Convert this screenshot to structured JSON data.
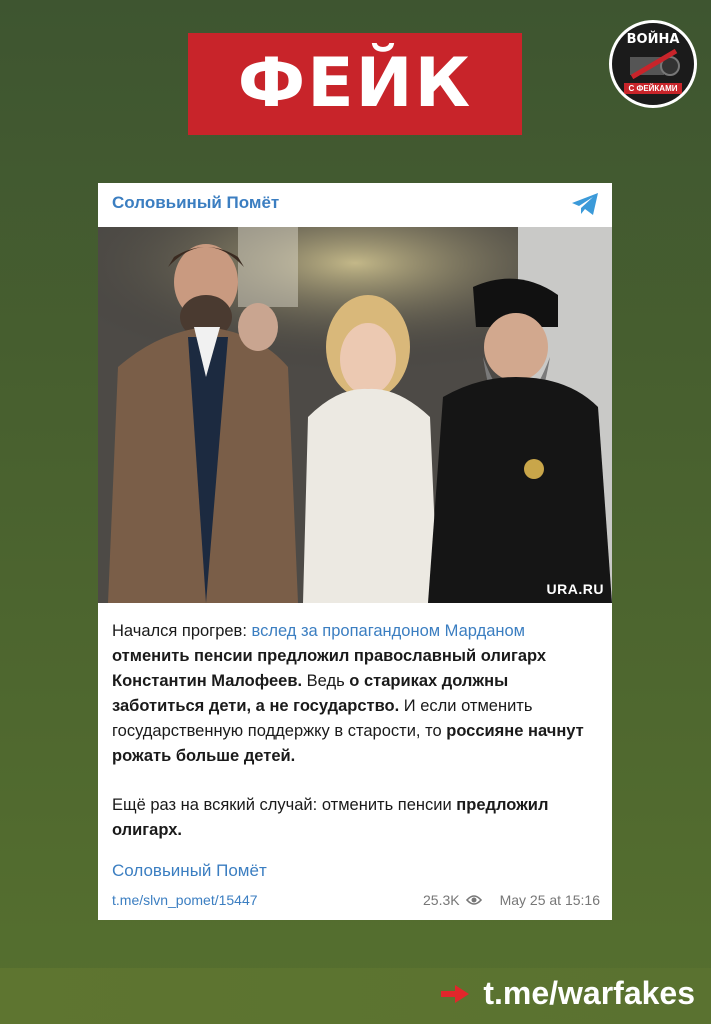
{
  "banner": {
    "label": "ФЕЙК"
  },
  "logo": {
    "top_text": "ВОЙНА",
    "bottom_text": "С ФЕЙКАМИ"
  },
  "post": {
    "channel": "Соловьиный Помёт",
    "photo_credit": "URA.RU",
    "p1_a": "Начался прогрев: ",
    "p1_link": "вслед за пропагандоном Марданом",
    "p1_b": " отменить пенсии предложил православный олигарх Константин Малофеев.",
    "p1_c": " Ведь ",
    "p1_d": "о стариках должны заботиться дети, а не государство.",
    "p1_e": " И если отменить государственную поддержку в старости, то ",
    "p1_f": "россияне начнут рожать больше детей.",
    "p2_a": "Ещё раз на всякий случай: отменить пенсии ",
    "p2_b": "предложил олигарх.",
    "signature": "Соловьиный Помёт",
    "link": "t.me/slvn_pomet/15447",
    "views": "25.3K",
    "timestamp": "May 25 at 15:16"
  },
  "footer": {
    "link": "t.me/warfakes"
  }
}
